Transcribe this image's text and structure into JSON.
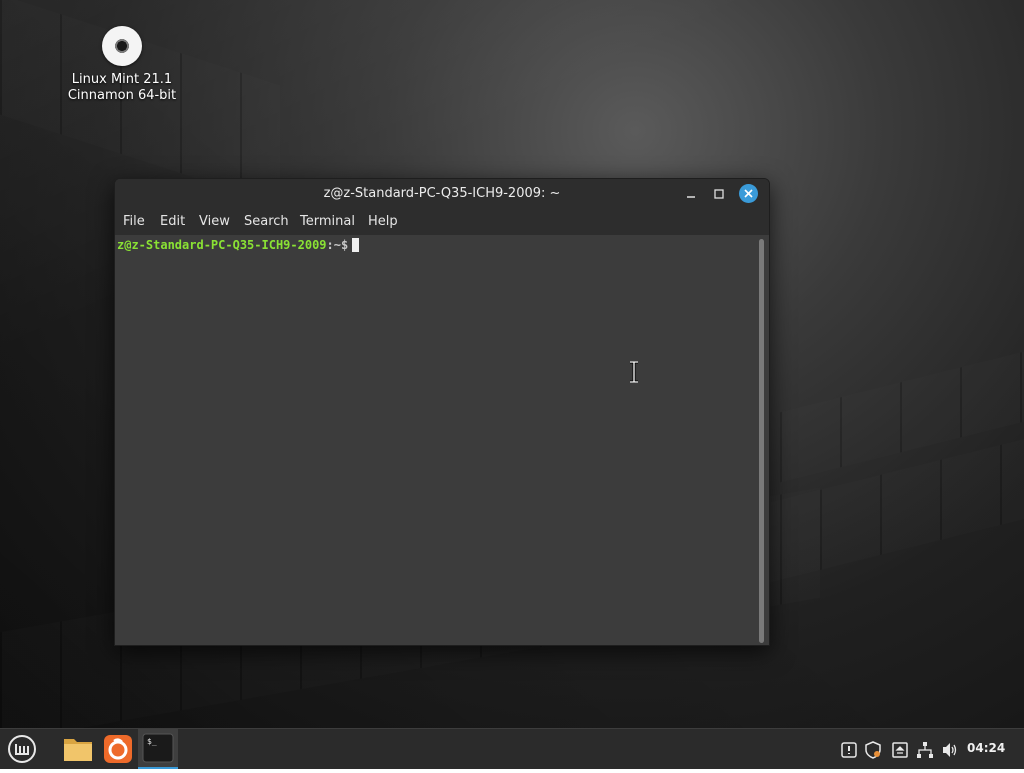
{
  "desktop": {
    "icon": {
      "name": "disc-icon",
      "label_line1": "Linux Mint 21.1",
      "label_line2": "Cinnamon 64-bit"
    }
  },
  "window": {
    "title": "z@z-Standard-PC-Q35-ICH9-2009: ~",
    "controls": {
      "minimize": "minimize-icon",
      "maximize": "maximize-icon",
      "close": "close-icon"
    },
    "menu": [
      "File",
      "Edit",
      "View",
      "Search",
      "Terminal",
      "Help"
    ]
  },
  "terminal": {
    "prompt_user": "z@z-Standard-PC-Q35-ICH9-2009",
    "prompt_path": ":~$"
  },
  "taskbar": {
    "launchers": [
      "mint-menu-icon",
      "files-icon",
      "firefox-icon",
      "terminal-icon"
    ],
    "tray_icons": [
      "update-manager-icon",
      "shield-icon",
      "removable-drive-icon",
      "network-icon",
      "volume-icon"
    ],
    "clock": "04:24"
  },
  "colors": {
    "accent": "#3a9bd9",
    "prompt_green": "#8ae234",
    "terminal_bg": "#3c3c3c",
    "titlebar_bg": "#2d2d2d",
    "taskbar_bg": "#2b2b2b"
  }
}
